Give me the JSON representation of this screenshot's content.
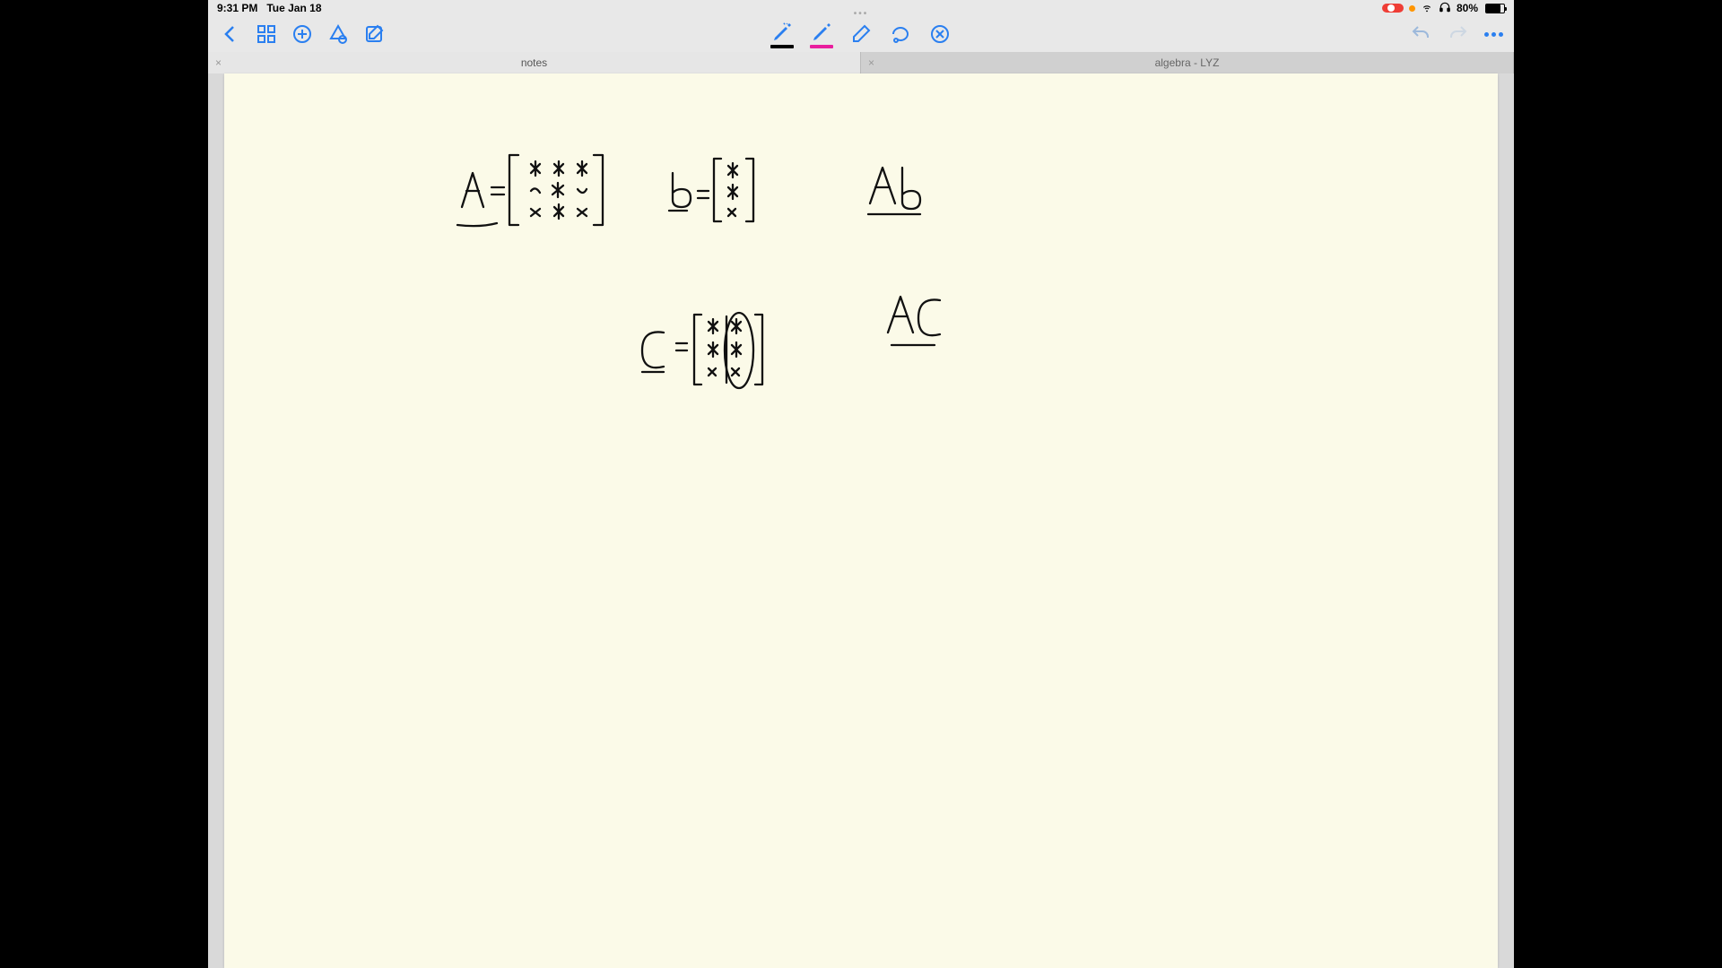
{
  "status": {
    "time": "9:31 PM",
    "date": "Tue Jan 18",
    "battery_pct": "80%"
  },
  "tabs": {
    "active": "notes",
    "inactive": "algebra - LYZ"
  },
  "colors": {
    "accent": "#2a7ff0",
    "pen1": "#000000",
    "pen2": "#e91e9e",
    "record": "#ef3d35"
  },
  "handwriting": {
    "eq1_label": "A =",
    "eq1_matrix": "3x3 matrix of stars",
    "eq2_label": "b =",
    "eq2_matrix": "3x1 column of stars",
    "eq3": "Ab",
    "eq4_label": "C =",
    "eq4_matrix": "3x2 matrix (two columns, second circled)",
    "eq5": "AC"
  }
}
